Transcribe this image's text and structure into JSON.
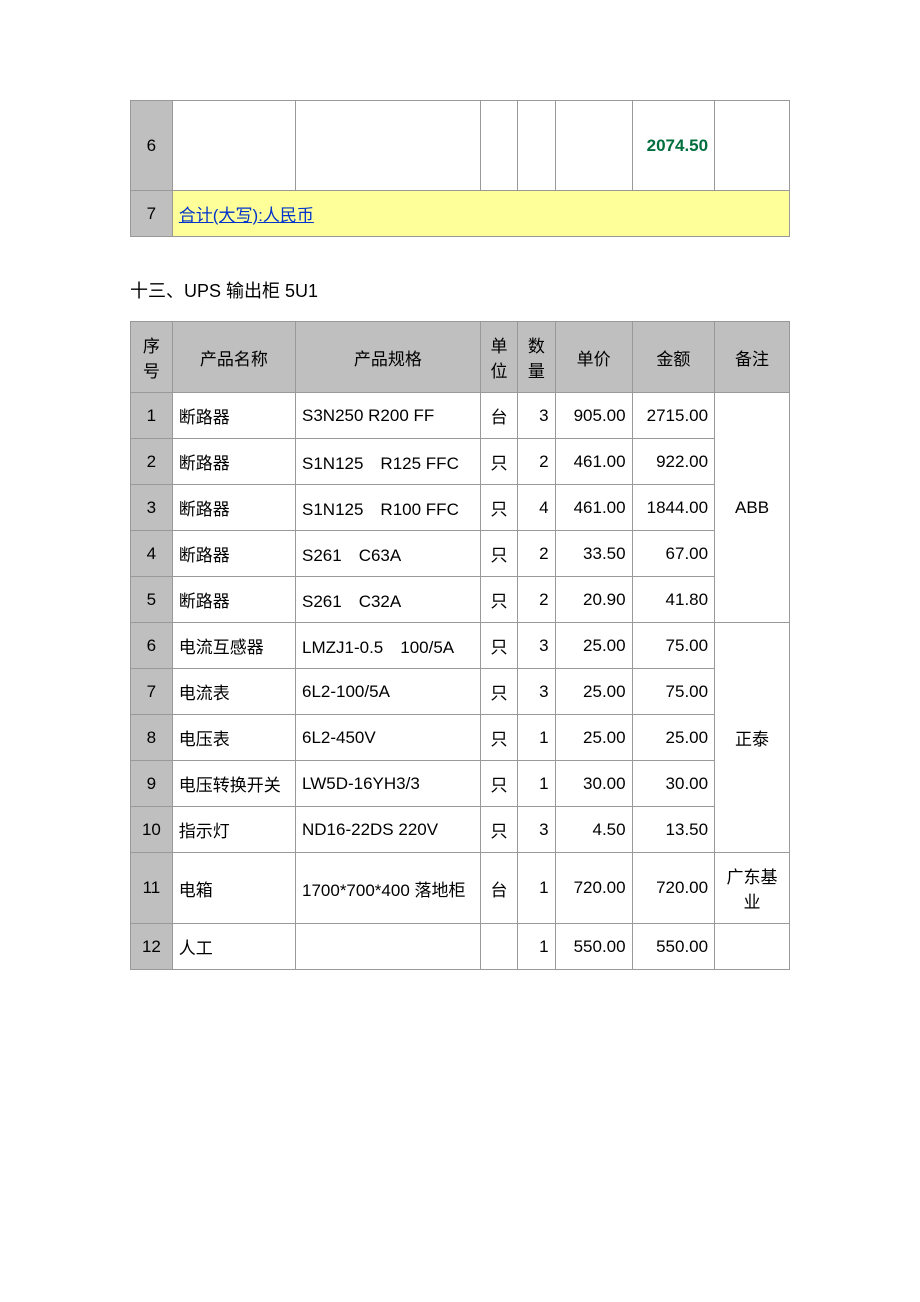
{
  "table1": {
    "rows": [
      {
        "seq": "6",
        "amount": "2074.50"
      },
      {
        "seq": "7",
        "total_label": "合计(大写):人民币  "
      }
    ]
  },
  "section_title": "十三、UPS 输出柜 5U1",
  "headers": {
    "seq": "序号",
    "name": "产品名称",
    "spec": "产品规格",
    "unit": "单位",
    "qty": "数量",
    "price": "单价",
    "amount": "金额",
    "remark": "备注"
  },
  "table2": {
    "rows": [
      {
        "seq": "1",
        "name": "断路器",
        "spec": "S3N250 R200 FF",
        "unit": "台",
        "qty": "3",
        "price": "905.00",
        "amount": "2715.00"
      },
      {
        "seq": "2",
        "name": "断路器",
        "spec": "S1N125　R125 FFC",
        "unit": "只",
        "qty": "2",
        "price": "461.00",
        "amount": "922.00"
      },
      {
        "seq": "3",
        "name": "断路器",
        "spec": "S1N125　R100 FFC",
        "unit": "只",
        "qty": "4",
        "price": "461.00",
        "amount": "1844.00"
      },
      {
        "seq": "4",
        "name": "断路器",
        "spec": "S261　C63A",
        "unit": "只",
        "qty": "2",
        "price": "33.50",
        "amount": "67.00"
      },
      {
        "seq": "5",
        "name": "断路器",
        "spec": "S261　C32A",
        "unit": "只",
        "qty": "2",
        "price": "20.90",
        "amount": "41.80"
      },
      {
        "seq": "6",
        "name": "电流互感器",
        "spec": "LMZJ1-0.5　100/5A",
        "unit": "只",
        "qty": "3",
        "price": "25.00",
        "amount": "75.00"
      },
      {
        "seq": "7",
        "name": "电流表",
        "spec": "6L2-100/5A",
        "unit": "只",
        "qty": "3",
        "price": "25.00",
        "amount": "75.00"
      },
      {
        "seq": "8",
        "name": "电压表",
        "spec": "6L2-450V",
        "unit": "只",
        "qty": "1",
        "price": "25.00",
        "amount": "25.00"
      },
      {
        "seq": "9",
        "name": "电压转换开关",
        "spec": "LW5D-16YH3/3",
        "unit": "只",
        "qty": "1",
        "price": "30.00",
        "amount": "30.00"
      },
      {
        "seq": "10",
        "name": "指示灯",
        "spec": "ND16-22DS 220V",
        "unit": "只",
        "qty": "3",
        "price": "4.50",
        "amount": "13.50"
      },
      {
        "seq": "11",
        "name": "电箱",
        "spec": "1700*700*400 落地柜",
        "unit": "台",
        "qty": "1",
        "price": "720.00",
        "amount": "720.00"
      },
      {
        "seq": "12",
        "name": "人工",
        "spec": "",
        "unit": "",
        "qty": "1",
        "price": "550.00",
        "amount": "550.00"
      }
    ],
    "remark_groups": [
      {
        "label": "ABB",
        "span": 5
      },
      {
        "label": "正泰",
        "span": 5
      },
      {
        "label": "广东基业",
        "span": 1
      },
      {
        "label": "",
        "span": 1
      }
    ]
  }
}
